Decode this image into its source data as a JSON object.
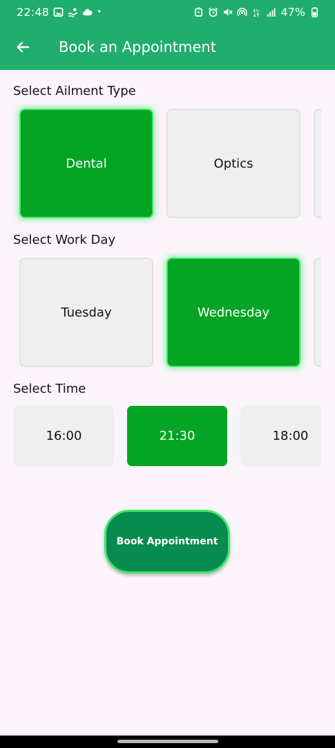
{
  "status_bar": {
    "time": "22:48",
    "dot": "•",
    "battery_percent": "47%",
    "network": "4G",
    "left_icons": [
      "gallery-icon",
      "hand-money-icon",
      "cloud-icon"
    ],
    "right_icons": [
      "battery-saver-icon",
      "alarm-icon",
      "mute-icon",
      "hotspot-icon",
      "network-4g-icon",
      "signal-icon",
      "battery-icon"
    ]
  },
  "app_bar": {
    "title": "Book an Appointment",
    "back_icon": "arrow-left-icon"
  },
  "ailment": {
    "label": "Select Ailment Type",
    "options": [
      "Dental",
      "Optics"
    ],
    "selected": "Dental"
  },
  "work_day": {
    "label": "Select Work Day",
    "options": [
      "Tuesday",
      "Wednesday"
    ],
    "selected": "Wednesday"
  },
  "time": {
    "label": "Select Time",
    "options": [
      "16:00",
      "21:30",
      "18:00"
    ],
    "selected": "21:30"
  },
  "book_button": {
    "label": "Book Appointment"
  },
  "colors": {
    "app_bar": "#20ad6e",
    "selected_card": "#05a424",
    "selected_glow": "#3ee86a",
    "unselected_card": "#efefef",
    "book_button": "#068c4e",
    "background": "#fbf4fb"
  }
}
